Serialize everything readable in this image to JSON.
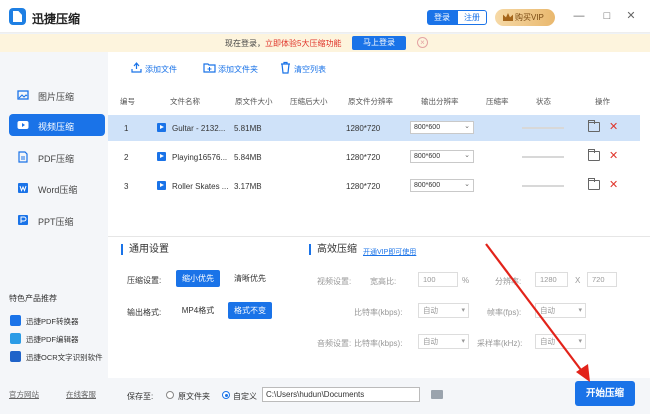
{
  "app": {
    "title": "迅捷压缩",
    "login": "登录",
    "register": "注册",
    "vip": "购买VIP"
  },
  "banner": {
    "prefix": "现在登录，",
    "highlight": "立即体验5大压缩功能",
    "button": "马上登录"
  },
  "sidebar": {
    "items": [
      {
        "label": "图片压缩",
        "icon": "image-icon"
      },
      {
        "label": "视频压缩",
        "icon": "video-icon",
        "active": true
      },
      {
        "label": "PDF压缩",
        "icon": "pdf-icon"
      },
      {
        "label": "Word压缩",
        "icon": "word-icon"
      },
      {
        "label": "PPT压缩",
        "icon": "ppt-icon"
      }
    ],
    "recommend_title": "特色产品推荐",
    "recommend": [
      {
        "label": "迅捷PDF转换器",
        "color": "#1a73e8"
      },
      {
        "label": "迅捷PDF编辑器",
        "color": "#2a9be6"
      },
      {
        "label": "迅捷OCR文字识别软件",
        "color": "#1f63c9"
      }
    ],
    "footer_left": "官方网站",
    "footer_right": "在线客服"
  },
  "toolbar": {
    "add_file": "添加文件",
    "add_folder": "添加文件夹",
    "clear_list": "清空列表"
  },
  "table": {
    "headers": [
      "编号",
      "文件名称",
      "原文件大小",
      "压缩后大小",
      "原文件分辨率",
      "输出分辨率",
      "压缩率",
      "状态",
      "操作"
    ],
    "rows": [
      {
        "index": "1",
        "name": "Gultar - 2132...",
        "size": "5.81MB",
        "resolution": "1280*720",
        "output": "800*600",
        "selected": true
      },
      {
        "index": "2",
        "name": "Playing16576...",
        "size": "5.84MB",
        "resolution": "1280*720",
        "output": "800*600",
        "selected": false
      },
      {
        "index": "3",
        "name": "Roller Skates ...",
        "size": "3.17MB",
        "resolution": "1280*720",
        "output": "800*600",
        "selected": false
      }
    ]
  },
  "general": {
    "title": "通用设置",
    "compress_label": "压缩设置:",
    "compress_options": [
      "缩小优先",
      "清晰优先"
    ],
    "format_label": "输出格式:",
    "format_options": [
      "MP4格式",
      "格式不变"
    ]
  },
  "advanced": {
    "title": "高效压缩",
    "vip_link": "开通VIP即可使用",
    "video_settings": "视频设置:",
    "width_ratio": "宽高比:",
    "width_ratio_value": "100",
    "percent": "%",
    "resolution_label": "分辨率:",
    "res_w": "1280",
    "res_x": "X",
    "res_h": "720",
    "bitrate_label": "比特率(kbps):",
    "auto": "自动",
    "framerate_label": "帧率(fps):",
    "audio_settings": "音频设置:",
    "audio_bitrate_label": "比特率(kbps):",
    "samplerate_label": "采样率(kHz):"
  },
  "footer": {
    "save_to": "保存至:",
    "option_original": "原文件夹",
    "option_custom": "自定义",
    "path": "C:\\Users\\hudun\\Documents",
    "start": "开始压缩"
  }
}
